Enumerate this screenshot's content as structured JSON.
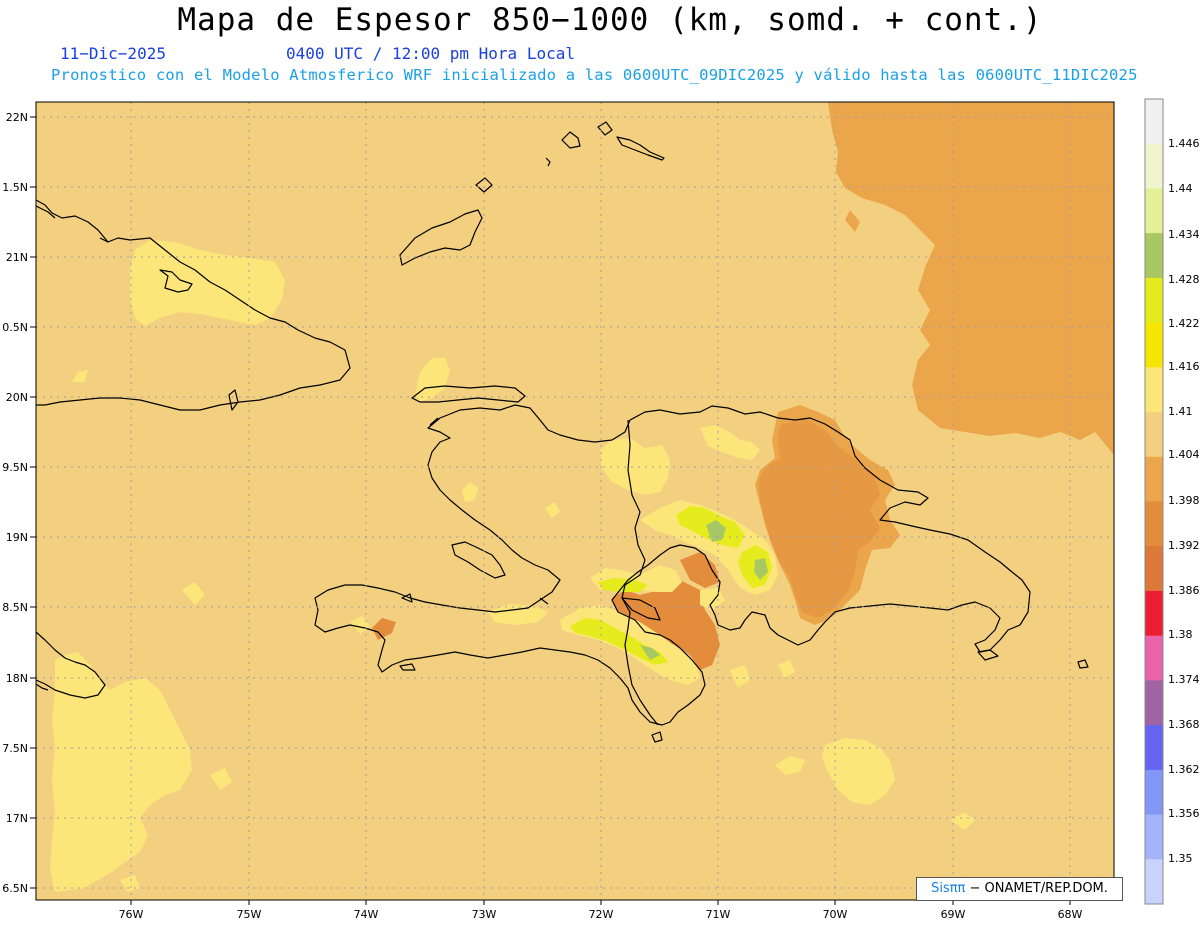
{
  "title": "Mapa de Espesor 850−1000 (km, somd. + cont.)",
  "date": "11−Dic−2025",
  "time": "0400 UTC / 12:00 pm Hora Local",
  "forecast_info": "Pronostico con el Modelo Atmosferico WRF inicializado a las 0600UTC_09DIC2025 y válido hasta las  0600UTC_11DIC2025",
  "lat_labels": [
    "22N",
    "1.5N",
    "21N",
    "0.5N",
    "20N",
    "9.5N",
    "19N",
    "8.5N",
    "18N",
    "7.5N",
    "17N",
    "6.5N"
  ],
  "lon_labels": [
    "76W",
    "75W",
    "74W",
    "73W",
    "72W",
    "71W",
    "70W",
    "69W",
    "68W"
  ],
  "colorbar": {
    "labels": [
      "1.446",
      "1.44",
      "1.434",
      "1.428",
      "1.422",
      "1.416",
      "1.41",
      "1.404",
      "1.398",
      "1.392",
      "1.386",
      "1.38",
      "1.374",
      "1.368",
      "1.362",
      "1.356",
      "1.35"
    ],
    "colors": [
      "#f0f0f0",
      "#f0f5cd",
      "#e4f096",
      "#a8c864",
      "#e6eb1e",
      "#f5e600",
      "#fce67a",
      "#f2d080",
      "#eba64b",
      "#e28c3c",
      "#dc7838",
      "#eb1e32",
      "#eb64aa",
      "#a064a5",
      "#6464f0",
      "#8296f5",
      "#a5b4fa",
      "#c8d2fa"
    ]
  },
  "map_colors": {
    "base": "#f2d080",
    "high": "#eba64b",
    "higher": "#e28c3c",
    "low": "#fce67a",
    "lower": "#e6eb1e",
    "lowest": "#a8c864",
    "coast": "#000000",
    "grid": "#a0a0a0"
  },
  "credit": {
    "sis": "Sisππ",
    "org": "− ONAMET/REP.DOM."
  }
}
